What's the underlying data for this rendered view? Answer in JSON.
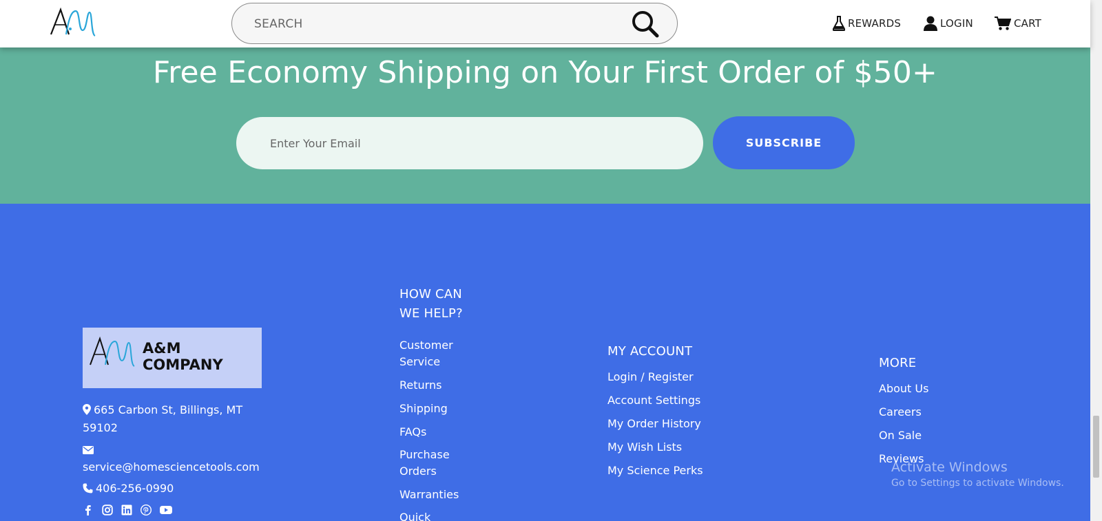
{
  "header": {
    "search_placeholder": "SEARCH",
    "rewards_label": "REWARDS",
    "login_label": "LOGIN",
    "cart_label": "CART"
  },
  "newsletter": {
    "title": "Free Economy Shipping on Your First Order of $50+",
    "email_placeholder": "Enter Your Email",
    "subscribe_label": "SUBSCRIBE"
  },
  "footer": {
    "brand": {
      "line1": "A&M",
      "line2": "COMPANY"
    },
    "address_line1": "665 Carbon St, Billings, MT",
    "address_line2": "59102",
    "email": "service@homesciencetools.com",
    "phone": "406-256-0990",
    "help": {
      "heading_line1": "HOW CAN",
      "heading_line2": "WE HELP?",
      "links": [
        "Customer",
        "Service",
        "Returns",
        "Shipping",
        "FAQs",
        "Purchase",
        "Orders",
        "Warranties",
        "Quick"
      ]
    },
    "account": {
      "heading": "MY ACCOUNT",
      "links": [
        "Login / Register",
        "Account Settings",
        "My Order History",
        "My Wish Lists",
        "My Science Perks"
      ]
    },
    "more": {
      "heading": "MORE",
      "links": [
        "About Us",
        "Careers",
        "On Sale",
        "Reviews"
      ]
    }
  },
  "os_overlay": {
    "line1": "Activate Windows",
    "line2": "Go to Settings to activate Windows."
  },
  "colors": {
    "green_band": "#61b29c",
    "footer_blue": "#3f6de6",
    "subscribe_button": "#3f6de6",
    "brand_box": "#c5d0f7"
  }
}
